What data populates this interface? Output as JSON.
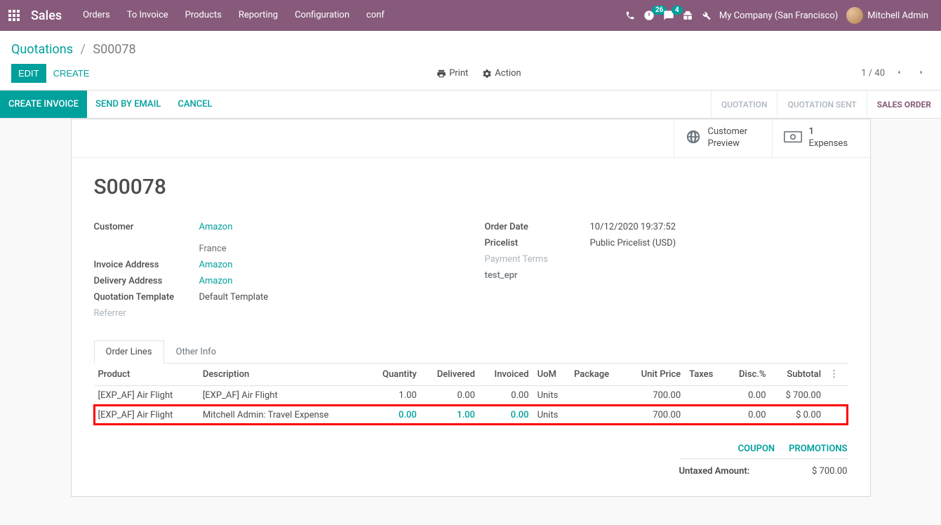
{
  "navbar": {
    "brand": "Sales",
    "menu": [
      "Orders",
      "To Invoice",
      "Products",
      "Reporting",
      "Configuration",
      "conf"
    ],
    "activities_count": "26",
    "messages_count": "4",
    "company": "My Company (San Francisco)",
    "user": "Mitchell Admin"
  },
  "breadcrumb": {
    "root": "Quotations",
    "current": "S00078"
  },
  "controls": {
    "edit": "EDIT",
    "create": "CREATE",
    "print": "Print",
    "action": "Action"
  },
  "pager": {
    "text": "1 / 40"
  },
  "actions": {
    "create_invoice": "CREATE INVOICE",
    "send_email": "SEND BY EMAIL",
    "cancel": "CANCEL"
  },
  "status": {
    "quotation": "QUOTATION",
    "quotation_sent": "QUOTATION SENT",
    "sales_order": "SALES ORDER"
  },
  "stat_buttons": {
    "preview": {
      "line1": "Customer",
      "line2": "Preview"
    },
    "expenses": {
      "count": "1",
      "label": "Expenses"
    }
  },
  "record": {
    "title": "S00078",
    "left": {
      "customer_label": "Customer",
      "customer_value": "Amazon",
      "customer_sub": "France",
      "invoice_addr_label": "Invoice Address",
      "invoice_addr_value": "Amazon",
      "delivery_addr_label": "Delivery Address",
      "delivery_addr_value": "Amazon",
      "template_label": "Quotation Template",
      "template_value": "Default Template",
      "referrer_label": "Referrer"
    },
    "right": {
      "order_date_label": "Order Date",
      "order_date_value": "10/12/2020 19:37:52",
      "pricelist_label": "Pricelist",
      "pricelist_value": "Public Pricelist (USD)",
      "payment_terms_label": "Payment Terms",
      "test_epr_label": "test_epr"
    }
  },
  "tabs": {
    "order_lines": "Order Lines",
    "other_info": "Other Info"
  },
  "table": {
    "headers": {
      "product": "Product",
      "description": "Description",
      "quantity": "Quantity",
      "delivered": "Delivered",
      "invoiced": "Invoiced",
      "uom": "UoM",
      "package": "Package",
      "unit_price": "Unit Price",
      "taxes": "Taxes",
      "disc": "Disc.%",
      "subtotal": "Subtotal"
    },
    "rows": [
      {
        "product": "[EXP_AF] Air Flight",
        "description": "[EXP_AF] Air Flight",
        "quantity": "1.00",
        "delivered": "0.00",
        "invoiced": "0.00",
        "uom": "Units",
        "package": "",
        "unit_price": "700.00",
        "taxes": "",
        "disc": "0.00",
        "subtotal": "$ 700.00"
      },
      {
        "product": "[EXP_AF] Air Flight",
        "description": "Mitchell Admin: Travel Expense",
        "quantity": "0.00",
        "delivered": "1.00",
        "invoiced": "0.00",
        "uom": "Units",
        "package": "",
        "unit_price": "700.00",
        "taxes": "",
        "disc": "0.00",
        "subtotal": "$ 0.00"
      }
    ]
  },
  "coupon": {
    "coupon": "COUPON",
    "promotions": "PROMOTIONS"
  },
  "totals": {
    "untaxed_label": "Untaxed Amount:",
    "untaxed_value": "$ 700.00"
  }
}
